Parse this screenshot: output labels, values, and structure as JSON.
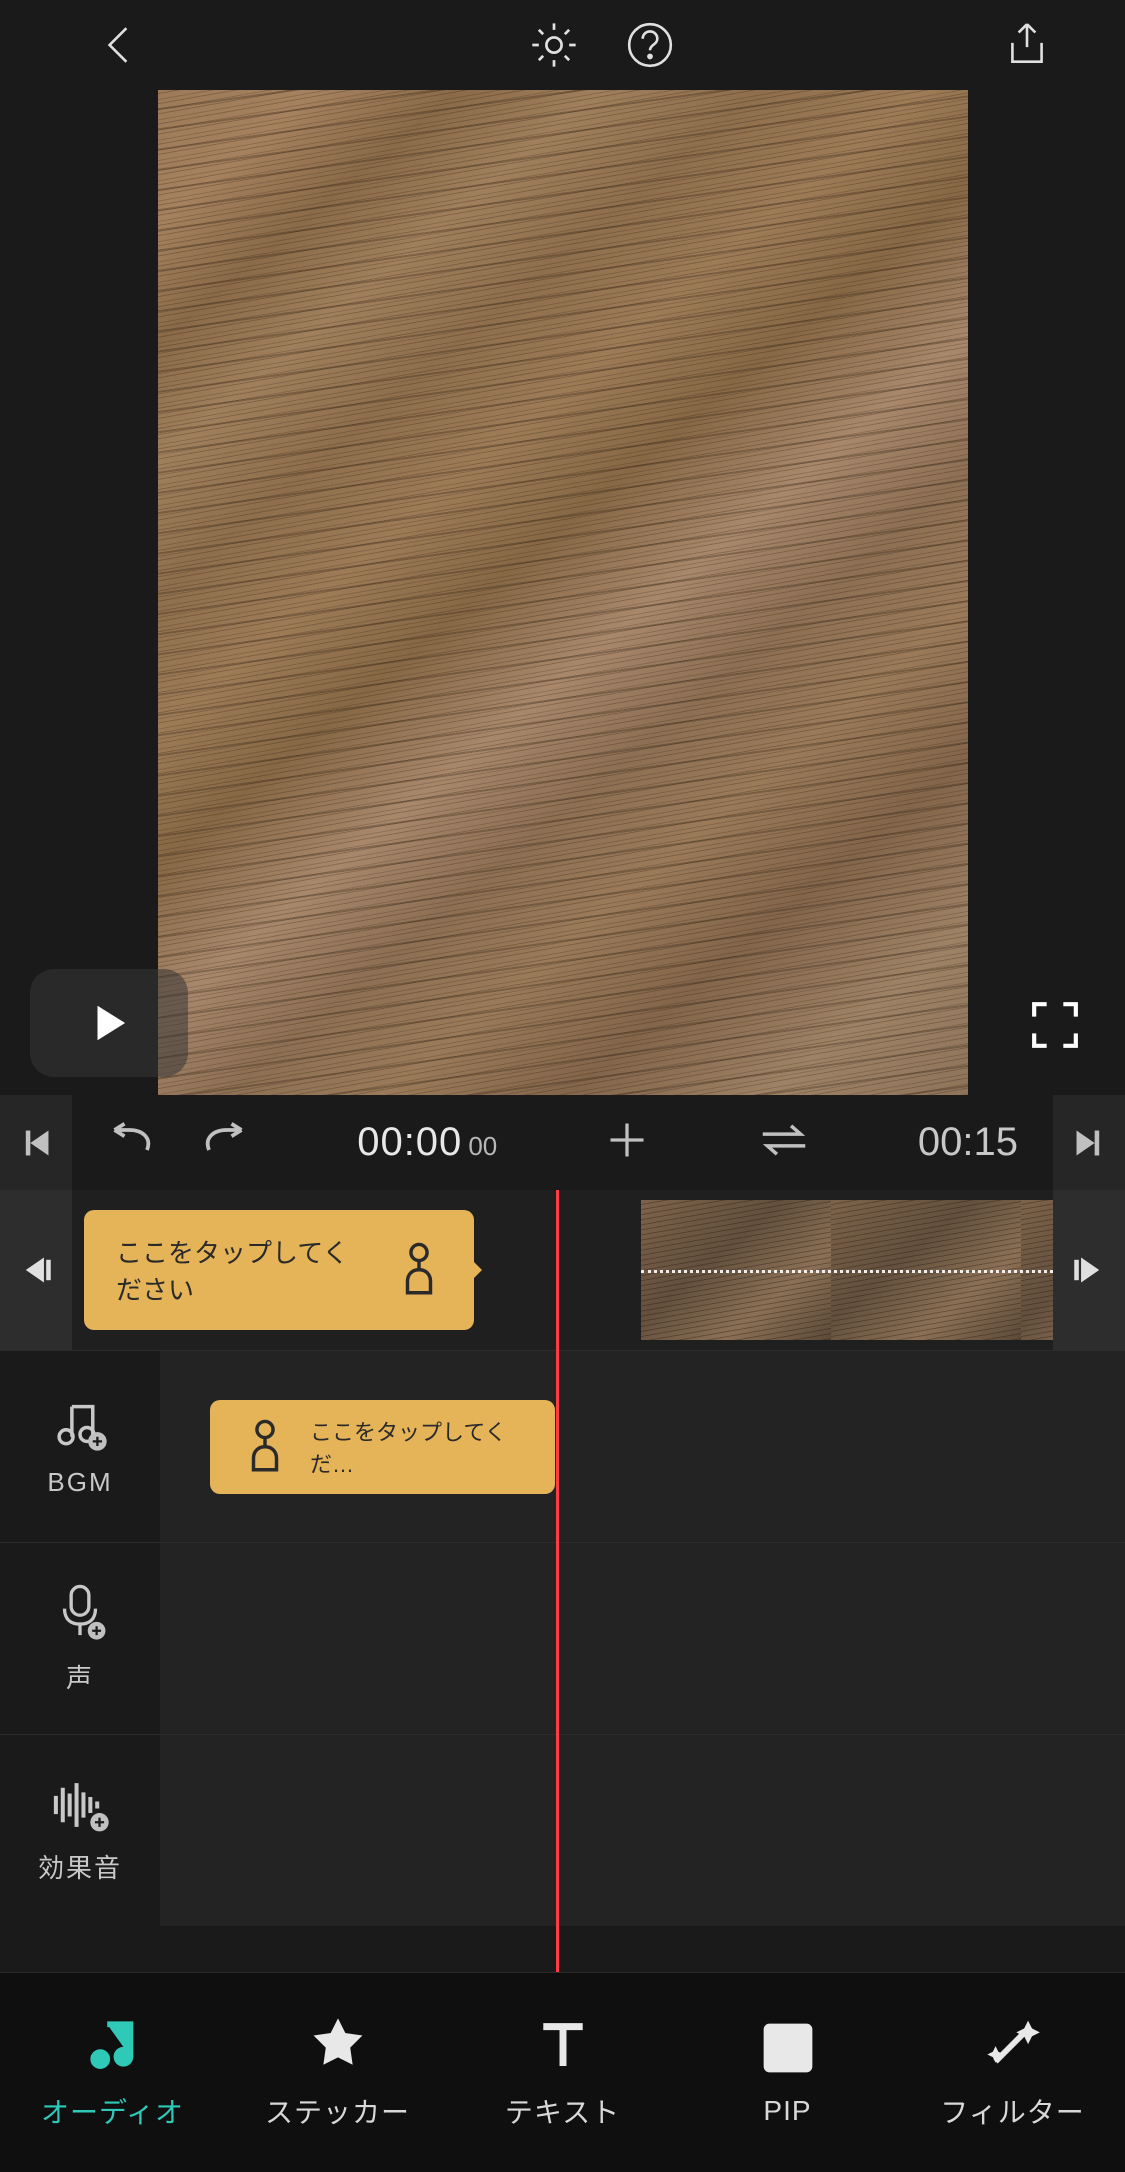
{
  "timeline": {
    "current_time": "00:00",
    "current_frames": "00",
    "duration": "00:15"
  },
  "tooltips": {
    "track": "ここをタップしてください",
    "bgm": "ここをタップしてくだ…"
  },
  "audio_tracks": [
    {
      "key": "bgm",
      "label": "BGM"
    },
    {
      "key": "voice",
      "label": "声"
    },
    {
      "key": "sfx",
      "label": "効果音"
    }
  ],
  "tabs": [
    {
      "key": "audio",
      "label": "オーディオ",
      "active": true
    },
    {
      "key": "sticker",
      "label": "ステッカー",
      "active": false
    },
    {
      "key": "text",
      "label": "テキスト",
      "active": false
    },
    {
      "key": "pip",
      "label": "PIP",
      "active": false
    },
    {
      "key": "filter",
      "label": "フィルター",
      "active": false
    }
  ],
  "colors": {
    "accent": "#2fc9b8",
    "tooltip_bg": "#e5b358",
    "playhead": "#ff3b46"
  }
}
